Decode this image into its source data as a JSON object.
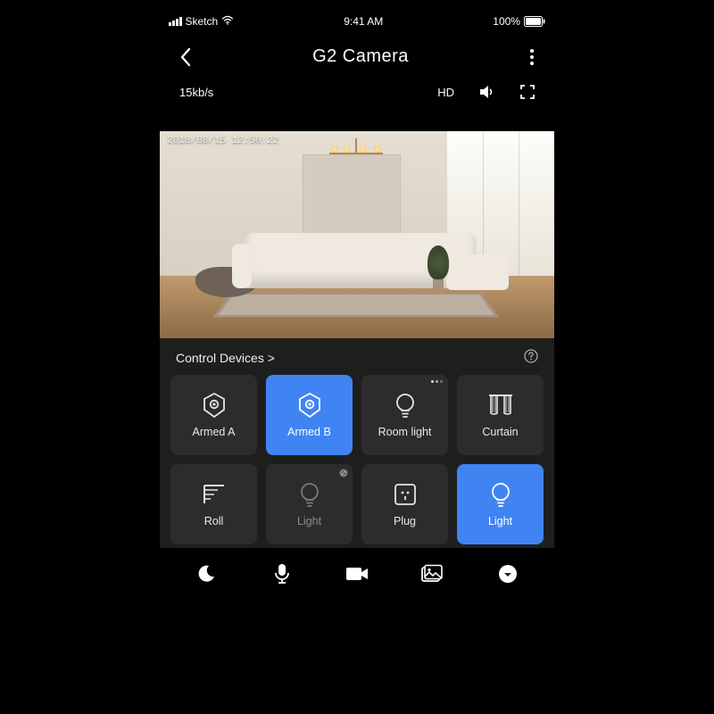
{
  "status": {
    "carrier": "Sketch",
    "time": "9:41 AM",
    "battery": "100%"
  },
  "nav": {
    "title": "G2 Camera"
  },
  "toolbar": {
    "bitrate": "15kb/s",
    "quality": "HD"
  },
  "feed": {
    "timestamp": "2018/08/15 12:50:22"
  },
  "controls": {
    "header": "Control Devices >",
    "tiles": [
      {
        "label": "Armed A",
        "icon": "shield-hexagon",
        "active": false
      },
      {
        "label": "Armed B",
        "icon": "shield-hexagon",
        "active": true
      },
      {
        "label": "Room light",
        "icon": "bulb",
        "active": false,
        "badge": "dots"
      },
      {
        "label": "Curtain",
        "icon": "curtain",
        "active": false
      },
      {
        "label": "Roll",
        "icon": "roller",
        "active": false
      },
      {
        "label": "Light",
        "icon": "bulb",
        "active": false,
        "dim": true,
        "badge": "disabled"
      },
      {
        "label": "Plug",
        "icon": "plug",
        "active": false
      },
      {
        "label": "Light",
        "icon": "bulb",
        "active": true
      }
    ]
  },
  "bottom": {
    "items": [
      "night",
      "mic",
      "record",
      "gallery",
      "more"
    ]
  }
}
